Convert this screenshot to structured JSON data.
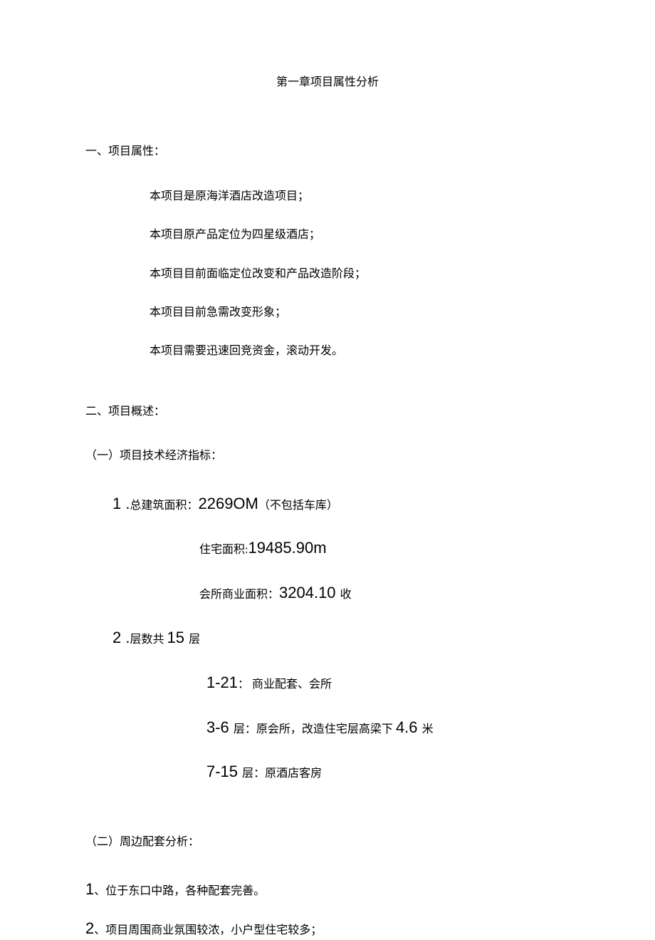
{
  "title": "第一章项目属性分析",
  "section1": {
    "heading": "一、项目属性：",
    "bullets": [
      "本项目是原海洋酒店改造项目；",
      "本项目原产品定位为四星级酒店；",
      "本项目目前面临定位改变和产品改造阶段；",
      "本项目目前急需改变形象；",
      "本项目需要迅速回竞资金，滚动开发。"
    ]
  },
  "section2": {
    "heading": "二、项目概述：",
    "sub1": {
      "heading": "（一）项目技术经济指标：",
      "item1": {
        "num": "1 .",
        "label": "总建筑面积：",
        "value": "2269OM",
        "note": "（不包括车库）"
      },
      "spec1": {
        "label": "住宅面积:",
        "value": "19485.90m"
      },
      "spec2": {
        "label": "会所商业面积：",
        "value": "3204.10 ",
        "unit": "收"
      },
      "item2": {
        "num": "2  .",
        "label": "层数共 ",
        "value": "15 ",
        "unit": "层"
      },
      "floor1": {
        "range": "1-21",
        "desc": "：  商业配套、会所"
      },
      "floor2": {
        "range": "3-6 ",
        "desc_pre": "层：原会所，改造住宅层高梁下 ",
        "value": "4.6 ",
        "unit": "米"
      },
      "floor3": {
        "range": "7-15 ",
        "desc": "层：原酒店客房"
      }
    },
    "sub2": {
      "heading": "（二）周边配套分析：",
      "item1": {
        "num": "1",
        "text": "、位于东口中路，各种配套完善。"
      },
      "item2": {
        "num": "2",
        "text": "、项目周围商业氛围较浓，小户型住宅较多；"
      }
    }
  }
}
